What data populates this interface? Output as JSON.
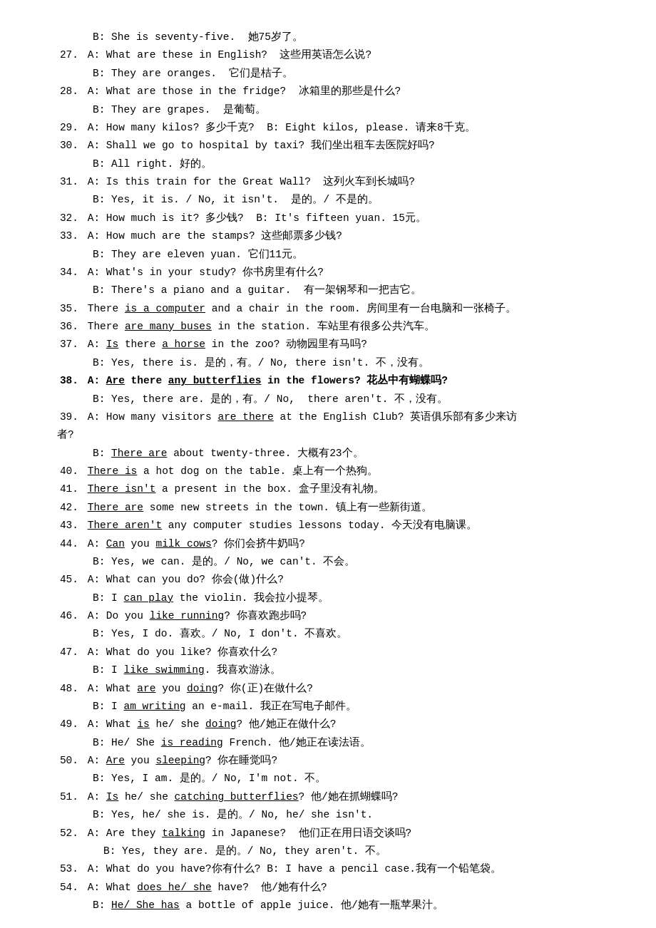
{
  "lines": [
    {
      "id": "l1",
      "indent": 1,
      "html": "B: She is seventy-five.&nbsp; 她75岁了。"
    },
    {
      "id": "l2",
      "indent": 0,
      "html": "<span class='num'>27.</span> A: What are these in English?&nbsp; 这些用英语怎么说?"
    },
    {
      "id": "l3",
      "indent": 1,
      "html": "B: They are oranges.&nbsp; 它们是桔子。"
    },
    {
      "id": "l4",
      "indent": 0,
      "html": "<span class='num'>28.</span> A: What are those in the fridge?&nbsp; 冰箱里的那些是什么?"
    },
    {
      "id": "l5",
      "indent": 1,
      "html": "B: They are grapes.&nbsp; 是葡萄。"
    },
    {
      "id": "l6",
      "indent": 0,
      "html": "<span class='num'>29.</span> A: How many kilos? 多少千克?&nbsp; B: Eight kilos, please. 请来8千克。"
    },
    {
      "id": "l7",
      "indent": 0,
      "html": "<span class='num'>30.</span> A: Shall we go to hospital by taxi? 我们坐出租车去医院好吗?"
    },
    {
      "id": "l8",
      "indent": 1,
      "html": "B: All right. 好的。"
    },
    {
      "id": "l9",
      "indent": 0,
      "html": "<span class='num'>31.</span> A: Is this train for the Great Wall?&nbsp; 这列火车到长城吗?"
    },
    {
      "id": "l10",
      "indent": 1,
      "html": "B: Yes, it is. / No, it isn't.&nbsp; 是的。/ 不是的。"
    },
    {
      "id": "l11",
      "indent": 0,
      "html": "<span class='num'>32.</span> A: How much is it? 多少钱?&nbsp; B: It's fifteen yuan. 15元。"
    },
    {
      "id": "l12",
      "indent": 0,
      "html": "<span class='num'>33.</span> A: How much are the stamps? 这些邮票多少钱?"
    },
    {
      "id": "l13",
      "indent": 1,
      "html": "B: They are eleven yuan. 它们11元。"
    },
    {
      "id": "l14",
      "indent": 0,
      "html": "<span class='num'>34.</span> A: What's in your study? 你书房里有什么?"
    },
    {
      "id": "l15",
      "indent": 1,
      "html": "B: There's a piano and a guitar.&nbsp; 有一架钢琴和一把吉它。"
    },
    {
      "id": "l16",
      "indent": 0,
      "html": "<span class='num'>35.</span> There <span class='underline'>is a computer</span> and a chair in the room. 房间里有一台电脑和一张椅子。"
    },
    {
      "id": "l17",
      "indent": 0,
      "html": "<span class='num'>36.</span> There <span class='underline'>are many buses</span> in the station. 车站里有很多公共汽车。"
    },
    {
      "id": "l18",
      "indent": 0,
      "html": "<span class='num'>37.</span> A: <span class='underline'>Is</span> there <span class='underline'>a horse</span> in the zoo? 动物园里有马吗?"
    },
    {
      "id": "l19",
      "indent": 1,
      "html": "B: Yes, there is. 是的，有。/ No, there isn't. 不，没有。"
    },
    {
      "id": "l20",
      "indent": 0,
      "html": "<span class='num bold'>38.</span> <span class='bold'>A: <span class='underline bold'>Are</span> there <span class='underline bold'>any butterflies</span> in the flowers? 花丛中有蝴蝶吗?</span>"
    },
    {
      "id": "l21",
      "indent": 1,
      "html": "B: Yes, there are. 是的，有。/ No,&nbsp; there aren't. 不，没有。"
    },
    {
      "id": "l22",
      "indent": 0,
      "html": "<span class='num'>39.</span> A: How many visitors <span class='underline'>are there</span> at the English Club? 英语俱乐部有多少来访"
    },
    {
      "id": "l23",
      "indent": 0,
      "html": "者?"
    },
    {
      "id": "l24",
      "indent": 1,
      "html": "B: <span class='underline'>There are</span> about twenty-three. 大概有23个。"
    },
    {
      "id": "l25",
      "indent": 0,
      "html": "<span class='num'>40.</span> <span class='underline'>There is</span> a hot dog on the table. 桌上有一个热狗。"
    },
    {
      "id": "l26",
      "indent": 0,
      "html": "<span class='num'>41.</span> <span class='underline'>There isn't</span> a present in the box. 盒子里没有礼物。"
    },
    {
      "id": "l27",
      "indent": 0,
      "html": "<span class='num'>42.</span> <span class='underline'>There are</span> some new streets in the town. 镇上有一些新街道。"
    },
    {
      "id": "l28",
      "indent": 0,
      "html": "<span class='num'>43.</span> <span class='underline'>There aren't</span> any computer studies lessons today. 今天没有电脑课。"
    },
    {
      "id": "l29",
      "indent": 0,
      "html": "<span class='num'>44.</span> A: <span class='underline'>Can</span> you <span class='underline'>milk cows</span>? 你们会挤牛奶吗?"
    },
    {
      "id": "l30",
      "indent": 1,
      "html": "B: Yes, we can. 是的。/ No, we can't. 不会。"
    },
    {
      "id": "l31",
      "indent": 0,
      "html": "<span class='num'>45.</span> A: What can you do? 你会(做)什么?"
    },
    {
      "id": "l32",
      "indent": 1,
      "html": "B: I <span class='underline'>can play</span> the violin. 我会拉小提琴。"
    },
    {
      "id": "l33",
      "indent": 0,
      "html": "<span class='num'>46.</span> A: Do you <span class='underline'>like running</span>? 你喜欢跑步吗?"
    },
    {
      "id": "l34",
      "indent": 1,
      "html": "B: Yes, I do. 喜欢。/ No, I don't. 不喜欢。"
    },
    {
      "id": "l35",
      "indent": 0,
      "html": "<span class='num'>47.</span> A: What do you like? 你喜欢什么?"
    },
    {
      "id": "l36",
      "indent": 1,
      "html": "B: I <span class='underline'>like swimming</span>. 我喜欢游泳。"
    },
    {
      "id": "l37",
      "indent": 0,
      "html": "<span class='num'>48.</span> A: What <span class='underline'>are</span> you <span class='underline'>doing</span>? 你(正)在做什么?"
    },
    {
      "id": "l38",
      "indent": 1,
      "html": "B: I <span class='underline'>am writing</span> an e-mail. 我正在写电子邮件。"
    },
    {
      "id": "l39",
      "indent": 0,
      "html": "<span class='num'>49.</span> A: What <span class='underline'>is</span> he/ she <span class='underline'>doing</span>? 他/她正在做什么?"
    },
    {
      "id": "l40",
      "indent": 1,
      "html": "B: He/ She <span class='underline'>is reading</span> French. 他/她正在读法语。"
    },
    {
      "id": "l41",
      "indent": 0,
      "html": "<span class='num'>50.</span> A: <span class='underline'>Are</span> you <span class='underline'>sleeping</span>? 你在睡觉吗?"
    },
    {
      "id": "l42",
      "indent": 1,
      "html": "B: Yes, I am. 是的。/ No, I'm not. 不。"
    },
    {
      "id": "l43",
      "indent": 0,
      "html": "<span class='num'>51.</span> A: <span class='underline'>Is</span> he/ she <span class='underline'>catching butterflies</span>? 他/她在抓蝴蝶吗?"
    },
    {
      "id": "l44",
      "indent": 1,
      "html": "B: Yes, he/ she is. 是的。/ No, he/ she isn't."
    },
    {
      "id": "l45",
      "indent": 0,
      "html": "<span class='num'>52.</span> A: Are they <span class='underline'>talking</span> in Japanese?&nbsp; 他们正在用日语交谈吗?"
    },
    {
      "id": "l46",
      "indent": 2,
      "html": "B: Yes, they are. 是的。/ No, they aren't. 不。"
    },
    {
      "id": "l47",
      "indent": 0,
      "html": "<span class='num'>53.</span> A: What do you have?你有什么? B: I have a pencil case.我有一个铅笔袋。"
    },
    {
      "id": "l48",
      "indent": 0,
      "html": "<span class='num'>54.</span> A: What <span class='underline'>does he/ she</span> have?&nbsp; 他/她有什么?"
    },
    {
      "id": "l49",
      "indent": 1,
      "html": "B: <span class='underline'>He/ She has</span> a bottle of apple juice. 他/她有一瓶苹果汁。"
    }
  ]
}
